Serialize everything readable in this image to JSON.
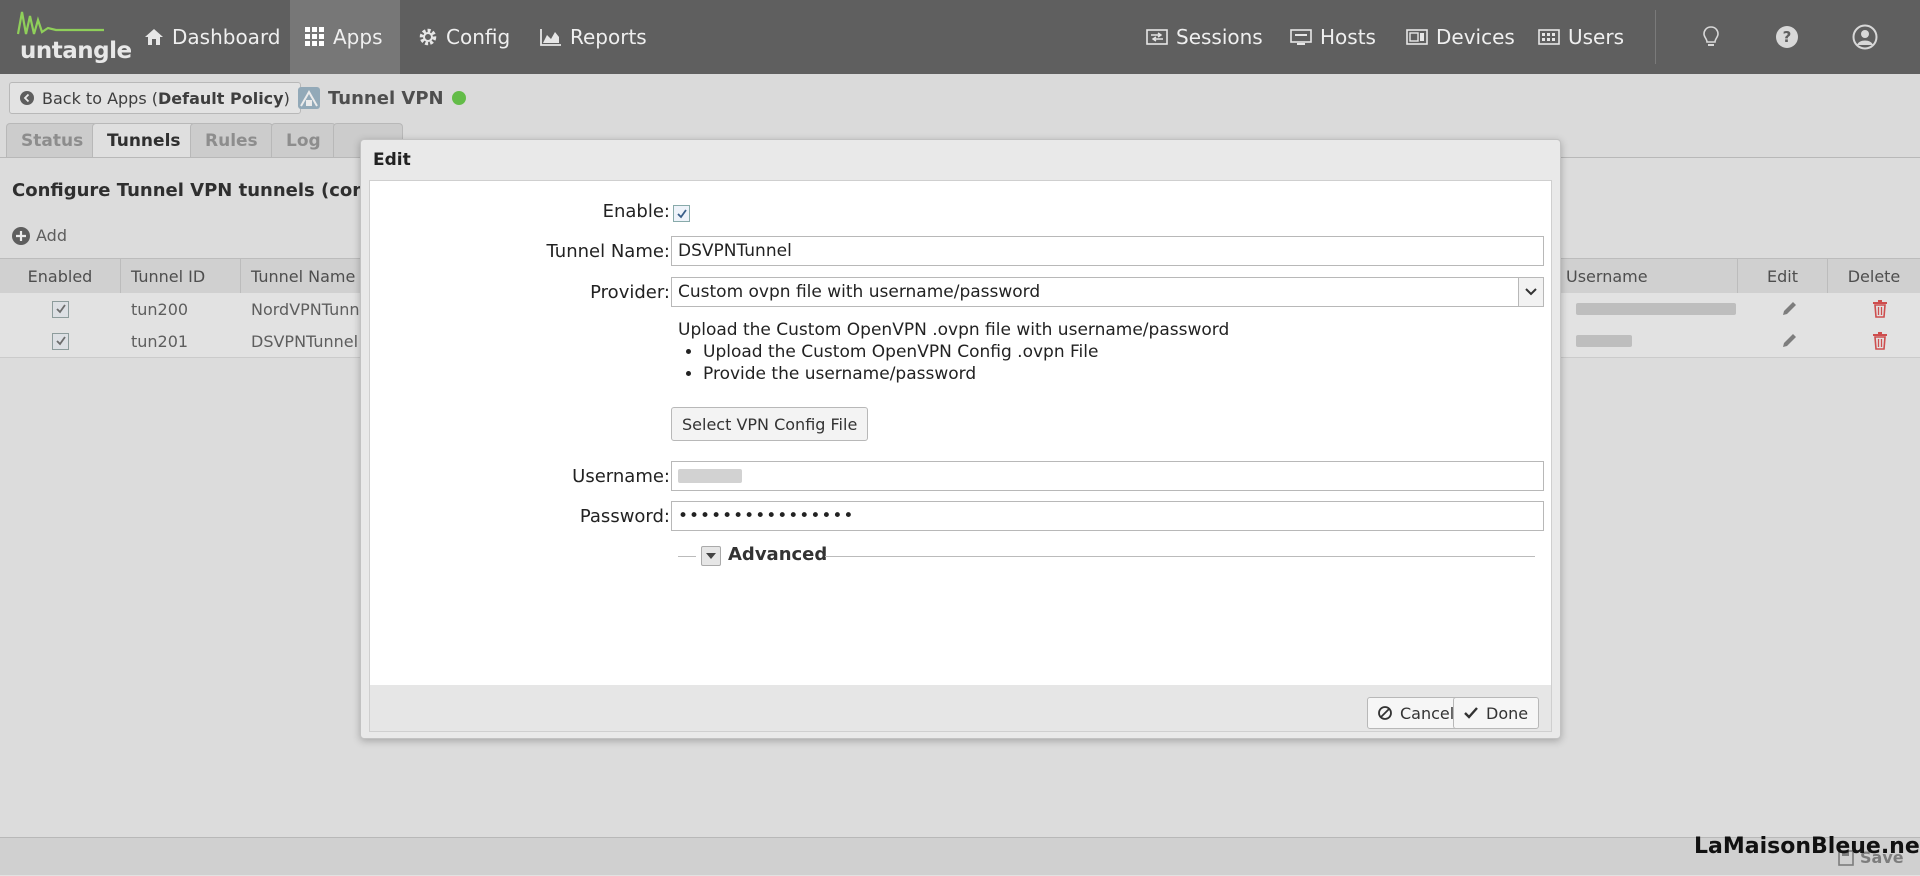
{
  "brand": {
    "logo_text": "untangle"
  },
  "nav": {
    "left": [
      {
        "label": "Dashboard",
        "icon": "home-icon"
      },
      {
        "label": "Apps",
        "icon": "grid-icon",
        "active": true
      },
      {
        "label": "Config",
        "icon": "gear-icon"
      },
      {
        "label": "Reports",
        "icon": "area-chart-icon"
      }
    ],
    "right": [
      {
        "label": "Sessions",
        "icon": "sessions-icon"
      },
      {
        "label": "Hosts",
        "icon": "hosts-icon"
      },
      {
        "label": "Devices",
        "icon": "devices-icon"
      },
      {
        "label": "Users",
        "icon": "users-icon"
      }
    ],
    "icons": [
      "lightbulb-icon",
      "help-icon",
      "account-icon"
    ]
  },
  "header": {
    "back_prefix": "Back to Apps (",
    "back_policy": "Default Policy",
    "back_suffix": ")",
    "app_title": "Tunnel VPN",
    "status_color": "#6ccd4f"
  },
  "tabs": [
    {
      "label": "Status"
    },
    {
      "label": "Tunnels",
      "active": true
    },
    {
      "label": "Rules"
    },
    {
      "label": "Log"
    }
  ],
  "panel": {
    "title": "Configure Tunnel VPN tunnels (connec",
    "add_label": "Add"
  },
  "grid": {
    "columns": [
      "Enabled",
      "Tunnel ID",
      "Tunnel Name",
      "Username",
      "Edit",
      "Delete"
    ],
    "rows": [
      {
        "tunnel_id": "tun200",
        "tunnel_name": "NordVPNTunne"
      },
      {
        "tunnel_id": "tun201",
        "tunnel_name": "DSVPNTunnel"
      }
    ]
  },
  "footer": {
    "save_label": "Save"
  },
  "watermark": "LaMaisonBleue.net",
  "modal": {
    "title": "Edit",
    "enable_label": "Enable:",
    "tunnel_name_label": "Tunnel Name:",
    "tunnel_name_value": "DSVPNTunnel",
    "provider_label": "Provider:",
    "provider_value": "Custom ovpn file with username/password",
    "description": "Upload the Custom OpenVPN .ovpn file with username/password",
    "steps": [
      "Upload the Custom OpenVPN Config .ovpn File",
      "Provide the username/password"
    ],
    "select_file_label": "Select VPN Config File",
    "username_label": "Username:",
    "password_label": "Password:",
    "password_value": "••••••••••••••••",
    "advanced_label": "Advanced",
    "cancel_label": "Cancel",
    "done_label": "Done"
  },
  "colors": {
    "topbar": "#5f5f5f",
    "delete": "#e05555",
    "status": "#6ccd4f"
  }
}
